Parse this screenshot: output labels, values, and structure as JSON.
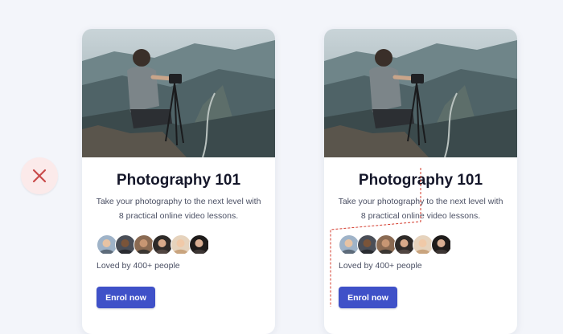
{
  "verdict_icon": "close-icon",
  "colors": {
    "accent": "#3f51c8",
    "verdict": "#c94a4a",
    "guide": "#d43c2e"
  },
  "cards": [
    {
      "title": "Photography 101",
      "description": "Take your photography to the next level with 8 practical online video lessons.",
      "social_proof": "Loved by 400+ people",
      "cta_label": "Enrol now"
    },
    {
      "title": "Photography 101",
      "description": "Take your photography to the next level with 8 practical online video lessons.",
      "social_proof": "Loved by 400+ people",
      "cta_label": "Enrol now"
    }
  ]
}
